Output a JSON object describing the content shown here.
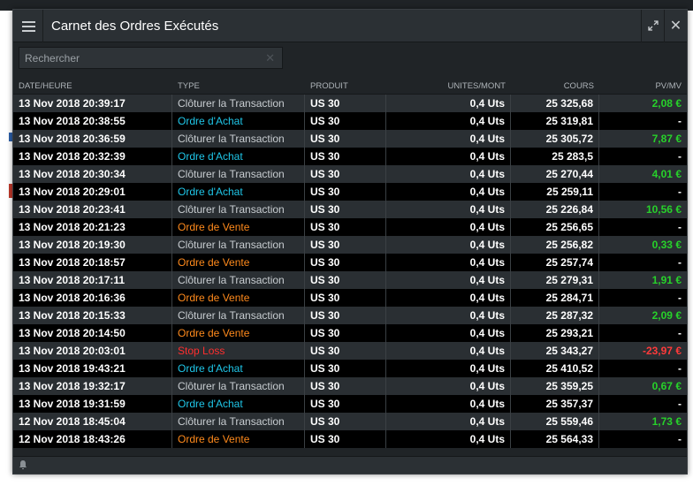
{
  "window": {
    "title": "Carnet des Ordres Exécutés",
    "search_placeholder": "Rechercher"
  },
  "columns": {
    "date": "DATE/HEURE",
    "type": "TYPE",
    "product": "PRODUIT",
    "units": "UNITES/MONT",
    "price": "COURS",
    "pv": "PV/MV"
  },
  "rows": [
    {
      "date": "13 Nov 2018 20:39:17",
      "type": "Clôturer la Transaction",
      "kind": "cloture",
      "product": "US 30",
      "units": "0,4 Uts",
      "price": "25 325,68",
      "pv": "2,08 €",
      "pv_sign": "pos"
    },
    {
      "date": "13 Nov 2018 20:38:55",
      "type": "Ordre d'Achat",
      "kind": "achat",
      "product": "US 30",
      "units": "0,4 Uts",
      "price": "25 319,81",
      "pv": "-",
      "pv_sign": "none"
    },
    {
      "date": "13 Nov 2018 20:36:59",
      "type": "Clôturer la Transaction",
      "kind": "cloture",
      "product": "US 30",
      "units": "0,4 Uts",
      "price": "25 305,72",
      "pv": "7,87 €",
      "pv_sign": "pos"
    },
    {
      "date": "13 Nov 2018 20:32:39",
      "type": "Ordre d'Achat",
      "kind": "achat",
      "product": "US 30",
      "units": "0,4 Uts",
      "price": "25 283,5",
      "pv": "-",
      "pv_sign": "none"
    },
    {
      "date": "13 Nov 2018 20:30:34",
      "type": "Clôturer la Transaction",
      "kind": "cloture",
      "product": "US 30",
      "units": "0,4 Uts",
      "price": "25 270,44",
      "pv": "4,01 €",
      "pv_sign": "pos"
    },
    {
      "date": "13 Nov 2018 20:29:01",
      "type": "Ordre d'Achat",
      "kind": "achat",
      "product": "US 30",
      "units": "0,4 Uts",
      "price": "25 259,11",
      "pv": "-",
      "pv_sign": "none"
    },
    {
      "date": "13 Nov 2018 20:23:41",
      "type": "Clôturer la Transaction",
      "kind": "cloture",
      "product": "US 30",
      "units": "0,4 Uts",
      "price": "25 226,84",
      "pv": "10,56 €",
      "pv_sign": "pos"
    },
    {
      "date": "13 Nov 2018 20:21:23",
      "type": "Ordre de Vente",
      "kind": "vente",
      "product": "US 30",
      "units": "0,4 Uts",
      "price": "25 256,65",
      "pv": "-",
      "pv_sign": "none"
    },
    {
      "date": "13 Nov 2018 20:19:30",
      "type": "Clôturer la Transaction",
      "kind": "cloture",
      "product": "US 30",
      "units": "0,4 Uts",
      "price": "25 256,82",
      "pv": "0,33 €",
      "pv_sign": "pos"
    },
    {
      "date": "13 Nov 2018 20:18:57",
      "type": "Ordre de Vente",
      "kind": "vente",
      "product": "US 30",
      "units": "0,4 Uts",
      "price": "25 257,74",
      "pv": "-",
      "pv_sign": "none"
    },
    {
      "date": "13 Nov 2018 20:17:11",
      "type": "Clôturer la Transaction",
      "kind": "cloture",
      "product": "US 30",
      "units": "0,4 Uts",
      "price": "25 279,31",
      "pv": "1,91 €",
      "pv_sign": "pos"
    },
    {
      "date": "13 Nov 2018 20:16:36",
      "type": "Ordre de Vente",
      "kind": "vente",
      "product": "US 30",
      "units": "0,4 Uts",
      "price": "25 284,71",
      "pv": "-",
      "pv_sign": "none"
    },
    {
      "date": "13 Nov 2018 20:15:33",
      "type": "Clôturer la Transaction",
      "kind": "cloture",
      "product": "US 30",
      "units": "0,4 Uts",
      "price": "25 287,32",
      "pv": "2,09 €",
      "pv_sign": "pos"
    },
    {
      "date": "13 Nov 2018 20:14:50",
      "type": "Ordre de Vente",
      "kind": "vente",
      "product": "US 30",
      "units": "0,4 Uts",
      "price": "25 293,21",
      "pv": "-",
      "pv_sign": "none"
    },
    {
      "date": "13 Nov 2018 20:03:01",
      "type": "Stop Loss",
      "kind": "stop",
      "product": "US 30",
      "units": "0,4 Uts",
      "price": "25 343,27",
      "pv": "-23,97 €",
      "pv_sign": "neg"
    },
    {
      "date": "13 Nov 2018 19:43:21",
      "type": "Ordre d'Achat",
      "kind": "achat",
      "product": "US 30",
      "units": "0,4 Uts",
      "price": "25 410,52",
      "pv": "-",
      "pv_sign": "none"
    },
    {
      "date": "13 Nov 2018 19:32:17",
      "type": "Clôturer la Transaction",
      "kind": "cloture",
      "product": "US 30",
      "units": "0,4 Uts",
      "price": "25 359,25",
      "pv": "0,67 €",
      "pv_sign": "pos"
    },
    {
      "date": "13 Nov 2018 19:31:59",
      "type": "Ordre d'Achat",
      "kind": "achat",
      "product": "US 30",
      "units": "0,4 Uts",
      "price": "25 357,37",
      "pv": "-",
      "pv_sign": "none"
    },
    {
      "date": "12 Nov 2018 18:45:04",
      "type": "Clôturer la Transaction",
      "kind": "cloture",
      "product": "US 30",
      "units": "0,4 Uts",
      "price": "25 559,46",
      "pv": "1,73 €",
      "pv_sign": "pos"
    },
    {
      "date": "12 Nov 2018 18:43:26",
      "type": "Ordre de Vente",
      "kind": "vente",
      "product": "US 30",
      "units": "0,4 Uts",
      "price": "25 564,33",
      "pv": "-",
      "pv_sign": "none"
    }
  ],
  "colors": {
    "achat": "#1fc6e8",
    "vente": "#ff8a1c",
    "stop": "#ff2e2e",
    "positive": "#27d12a",
    "negative": "#ff3a3a"
  },
  "icons": {
    "menu": "hamburger-icon",
    "expand": "expand-icon",
    "close": "close-icon",
    "clear": "clear-icon",
    "footer": "bell-icon"
  }
}
